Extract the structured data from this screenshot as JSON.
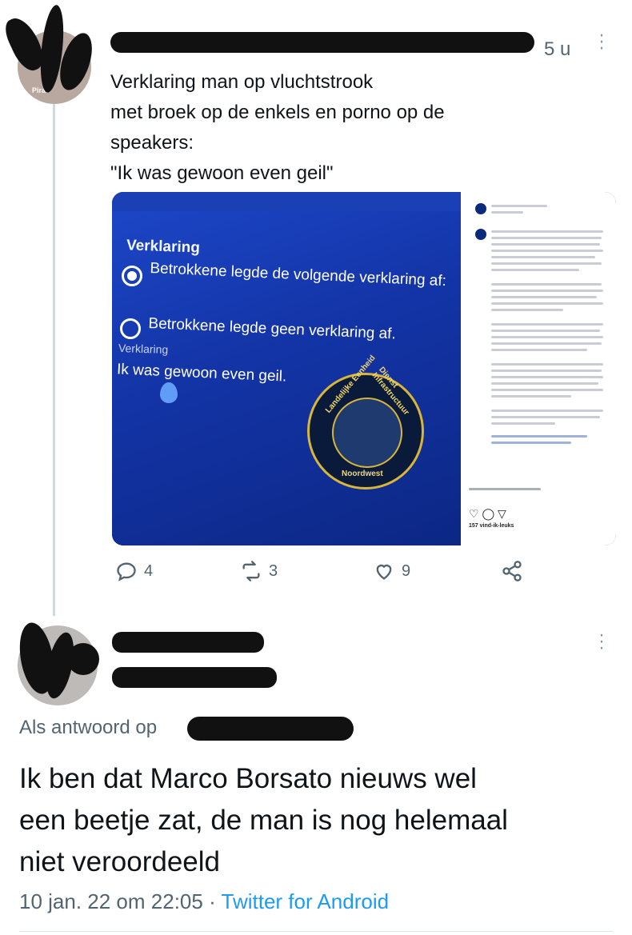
{
  "tweet1": {
    "time": "5 u",
    "text": "Verklaring man op vluchtstrook\nmet broek op de enkels en porno op de\nspeakers:\n\"Ik was gewoon even geil\"",
    "avatar_caption": "Pirat",
    "media": {
      "form_title": "Verklaring",
      "option1": "Betrokkene legde de volgende verklaring af:",
      "option2": "Betrokkene legde geen verklaring af.",
      "field_label": "Verklaring",
      "field_value": "Ik was gewoon even geil.",
      "badge_top": "Landelijke Eenheid",
      "badge_right": "Dienst Infrastructuur",
      "badge_bottom": "Noordwest",
      "instagram_likes": "157 vind-ik-leuks"
    },
    "actions": {
      "replies": "4",
      "retweets": "3",
      "likes": "9"
    }
  },
  "tweet2": {
    "reply_prefix": "Als antwoord op",
    "text": "Ik ben dat Marco Borsato nieuws wel\neen beetje zat, de man is nog helemaal\nniet veroordeeld",
    "date": "10 jan. 22 om 22:05",
    "separator": "·",
    "source": "Twitter for Android"
  },
  "colors": {
    "accent": "#1d9bf0",
    "secondary_text": "#536471",
    "thread_line": "#cfd9de"
  },
  "icons": [
    "reply-icon",
    "retweet-icon",
    "like-icon",
    "share-icon",
    "more-icon"
  ]
}
